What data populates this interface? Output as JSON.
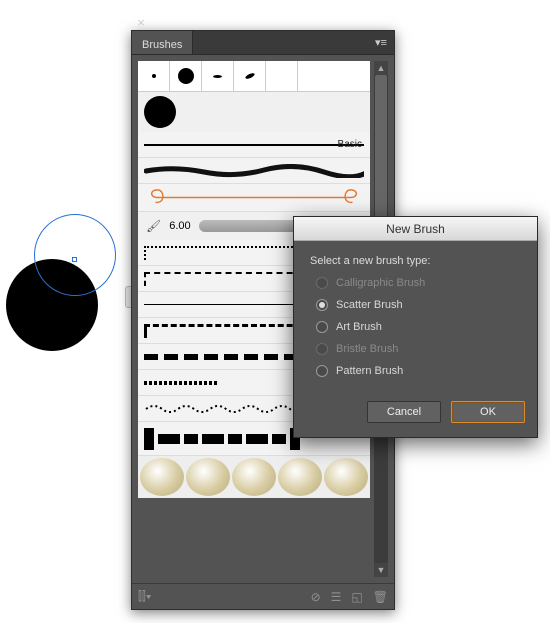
{
  "panel": {
    "tab_label": "Brushes",
    "basic_label": "Basic",
    "bristle_value": "6.00"
  },
  "dialog": {
    "title": "New Brush",
    "prompt": "Select a new brush type:",
    "options": [
      {
        "label": "Calligraphic Brush",
        "enabled": false,
        "checked": false
      },
      {
        "label": "Scatter Brush",
        "enabled": true,
        "checked": true
      },
      {
        "label": "Art Brush",
        "enabled": true,
        "checked": false
      },
      {
        "label": "Bristle Brush",
        "enabled": false,
        "checked": false
      },
      {
        "label": "Pattern Brush",
        "enabled": true,
        "checked": false
      }
    ],
    "cancel_label": "Cancel",
    "ok_label": "OK"
  }
}
